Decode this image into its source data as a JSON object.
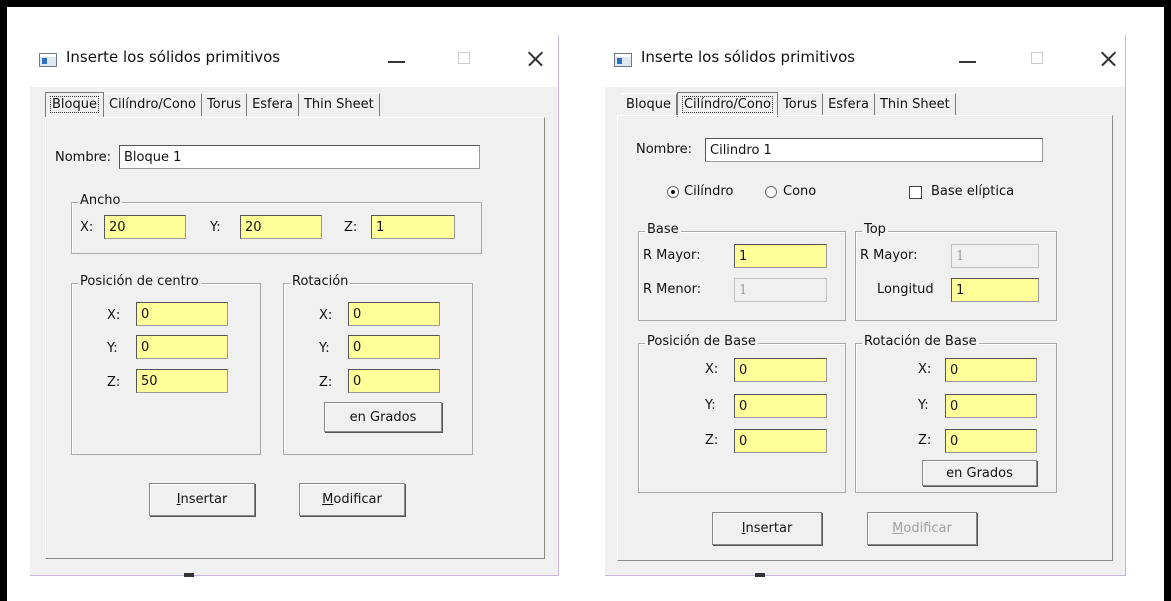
{
  "left_window": {
    "title": "Inserte los sólidos primitivos",
    "tabs": [
      "Bloque",
      "Cilíndro/Cono",
      "Torus",
      "Esfera",
      "Thin Sheet"
    ],
    "nombre_label": "Nombre:",
    "nombre_value": "Bloque 1",
    "ancho": {
      "title": "Ancho",
      "x_label": "X:",
      "x_value": "20",
      "y_label": "Y:",
      "y_value": "20",
      "z_label": "Z:",
      "z_value": "1"
    },
    "posicion": {
      "title": "Posición de centro",
      "x_label": "X:",
      "x_value": "0",
      "y_label": "Y:",
      "y_value": "0",
      "z_label": "Z:",
      "z_value": "50"
    },
    "rotacion": {
      "title": "Rotación",
      "x_label": "X:",
      "x_value": "0",
      "y_label": "Y:",
      "y_value": "0",
      "z_label": "Z:",
      "z_value": "0",
      "grados_button": "en Grados"
    },
    "insertar_first": "I",
    "insertar_rest": "nsertar",
    "modificar_first": "M",
    "modificar_rest": "odificar"
  },
  "right_window": {
    "title": "Inserte los sólidos primitivos",
    "tabs": [
      "Bloque",
      "Cilíndro/Cono",
      "Torus",
      "Esfera",
      "Thin Sheet"
    ],
    "nombre_label": "Nombre:",
    "nombre_value": "Cilindro 1",
    "radio_cilindro": "Cilíndro",
    "radio_cono": "Cono",
    "base_eliptica": "Base elíptica",
    "base": {
      "title": "Base",
      "rmayor_label": "R Mayor:",
      "rmayor_value": "1",
      "rmenor_label": "R Menor:",
      "rmenor_value": "1"
    },
    "top": {
      "title": "Top",
      "rmayor_label": "R Mayor:",
      "rmayor_value": "1",
      "longitud_label": "Longitud",
      "longitud_value": "1"
    },
    "posicion_base": {
      "title": "Posición de Base",
      "x_label": "X:",
      "x_value": "0",
      "y_label": "Y:",
      "y_value": "0",
      "z_label": "Z:",
      "z_value": "0"
    },
    "rotacion_base": {
      "title": "Rotación de Base",
      "x_label": "X:",
      "x_value": "0",
      "y_label": "Y:",
      "y_value": "0",
      "z_label": "Z:",
      "z_value": "0",
      "grados_button": "en Grados"
    },
    "insertar_first": "I",
    "insertar_rest": "nsertar",
    "modificar_first": "M",
    "modificar_rest": "odificar"
  },
  "colors": {
    "input_highlight": "#ffff99",
    "window_bg": "#f0f0f0",
    "title_bg": "#ffffff"
  }
}
